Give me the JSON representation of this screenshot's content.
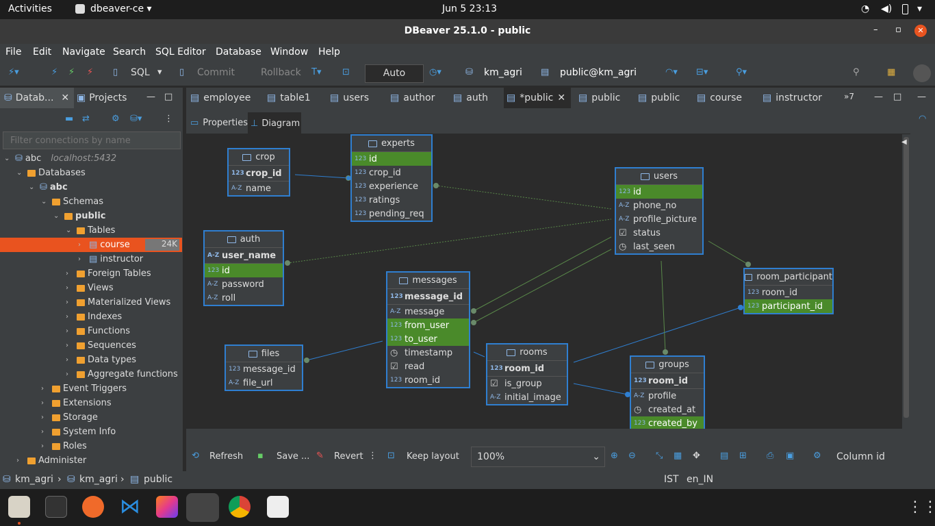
{
  "system": {
    "activities": "Activities",
    "app_menu": "dbeaver-ce",
    "clock": "Jun 5  23:13"
  },
  "window": {
    "title": "DBeaver 25.1.0 - public"
  },
  "menu": [
    "File",
    "Edit",
    "Navigate",
    "Search",
    "SQL Editor",
    "Database",
    "Window",
    "Help"
  ],
  "toolbar": {
    "sql": "SQL",
    "commit": "Commit",
    "rollback": "Rollback",
    "tx_mode": "Auto",
    "connection": "km_agri",
    "schema": "public@km_agri"
  },
  "left_tabs": {
    "databases": "Datab...",
    "projects": "Projects"
  },
  "filter_placeholder": "Filter connections by name",
  "tree": [
    {
      "label": "abc",
      "extra": "localhost:5432",
      "indent": 0
    },
    {
      "label": "Databases",
      "indent": 1
    },
    {
      "label": "abc",
      "indent": 2,
      "bold": true
    },
    {
      "label": "Schemas",
      "indent": 3
    },
    {
      "label": "public",
      "indent": 4,
      "bold": true
    },
    {
      "label": "Tables",
      "indent": 5
    },
    {
      "label": "course",
      "indent": 6,
      "badge": "24K",
      "selected": true
    },
    {
      "label": "instructor",
      "indent": 6
    },
    {
      "label": "Foreign Tables",
      "indent": 5
    },
    {
      "label": "Views",
      "indent": 5
    },
    {
      "label": "Materialized Views",
      "indent": 5
    },
    {
      "label": "Indexes",
      "indent": 5
    },
    {
      "label": "Functions",
      "indent": 5
    },
    {
      "label": "Sequences",
      "indent": 5
    },
    {
      "label": "Data types",
      "indent": 5
    },
    {
      "label": "Aggregate functions",
      "indent": 5
    },
    {
      "label": "Event Triggers",
      "indent": 3
    },
    {
      "label": "Extensions",
      "indent": 3
    },
    {
      "label": "Storage",
      "indent": 3
    },
    {
      "label": "System Info",
      "indent": 3
    },
    {
      "label": "Roles",
      "indent": 3
    },
    {
      "label": "Administer",
      "indent": 1
    }
  ],
  "editor_tabs": [
    "employee",
    "table1",
    "users",
    "author",
    "auth",
    "*public",
    "public",
    "public",
    "course",
    "instructor"
  ],
  "editor_tabs_more": "»7",
  "sub_tabs": {
    "properties": "Properties",
    "diagram": "Diagram"
  },
  "entities": {
    "crop": {
      "title": "crop",
      "rows": [
        {
          "t": "123",
          "n": "crop_id",
          "pk": true
        },
        {
          "t": "A-Z",
          "n": "name"
        }
      ]
    },
    "experts": {
      "title": "experts",
      "rows": [
        {
          "t": "123",
          "n": "id",
          "hl": true
        },
        {
          "t": "123",
          "n": "crop_id"
        },
        {
          "t": "123",
          "n": "experience"
        },
        {
          "t": "123",
          "n": "ratings"
        },
        {
          "t": "123",
          "n": "pending_req"
        }
      ]
    },
    "users": {
      "title": "users",
      "rows": [
        {
          "t": "123",
          "n": "id",
          "hl": true
        },
        {
          "t": "A-Z",
          "n": "phone_no"
        },
        {
          "t": "A-Z",
          "n": "profile_picture"
        },
        {
          "t": "chk",
          "n": "status"
        },
        {
          "t": "clk",
          "n": "last_seen"
        }
      ]
    },
    "auth": {
      "title": "auth",
      "rows": [
        {
          "t": "A-Z",
          "n": "user_name",
          "pk": true
        },
        {
          "t": "123",
          "n": "id",
          "hl": true
        },
        {
          "t": "A-Z",
          "n": "password"
        },
        {
          "t": "A-Z",
          "n": "roll"
        }
      ]
    },
    "messages": {
      "title": "messages",
      "rows": [
        {
          "t": "123",
          "n": "message_id",
          "pk": true
        },
        {
          "t": "A-Z",
          "n": "message"
        },
        {
          "t": "123",
          "n": "from_user",
          "hl": true
        },
        {
          "t": "123",
          "n": "to_user",
          "hl": true
        },
        {
          "t": "clk",
          "n": "timestamp"
        },
        {
          "t": "chk",
          "n": "read"
        },
        {
          "t": "123",
          "n": "room_id"
        }
      ]
    },
    "room_participant": {
      "title": "room_participant",
      "rows": [
        {
          "t": "123",
          "n": "room_id"
        },
        {
          "t": "123",
          "n": "participant_id",
          "hl": true
        }
      ]
    },
    "files": {
      "title": "files",
      "rows": [
        {
          "t": "123",
          "n": "message_id"
        },
        {
          "t": "A-Z",
          "n": "file_url"
        }
      ]
    },
    "rooms": {
      "title": "rooms",
      "rows": [
        {
          "t": "123",
          "n": "room_id",
          "pk": true
        },
        {
          "t": "chk",
          "n": "is_group"
        },
        {
          "t": "A-Z",
          "n": "initial_image"
        }
      ]
    },
    "groups": {
      "title": "groups",
      "rows": [
        {
          "t": "123",
          "n": "room_id",
          "pk": true
        },
        {
          "t": "A-Z",
          "n": "profile"
        },
        {
          "t": "clk",
          "n": "created_at"
        },
        {
          "t": "123",
          "n": "created_by",
          "hl": true
        }
      ]
    }
  },
  "bottom_toolbar": {
    "refresh": "Refresh",
    "save": "Save ...",
    "revert": "Revert",
    "keep_layout": "Keep layout",
    "zoom": "100%",
    "column": "Column id"
  },
  "status": {
    "path1": "km_agri",
    "path2": "km_agri",
    "path3": "public",
    "tz": "IST",
    "locale": "en_IN"
  }
}
